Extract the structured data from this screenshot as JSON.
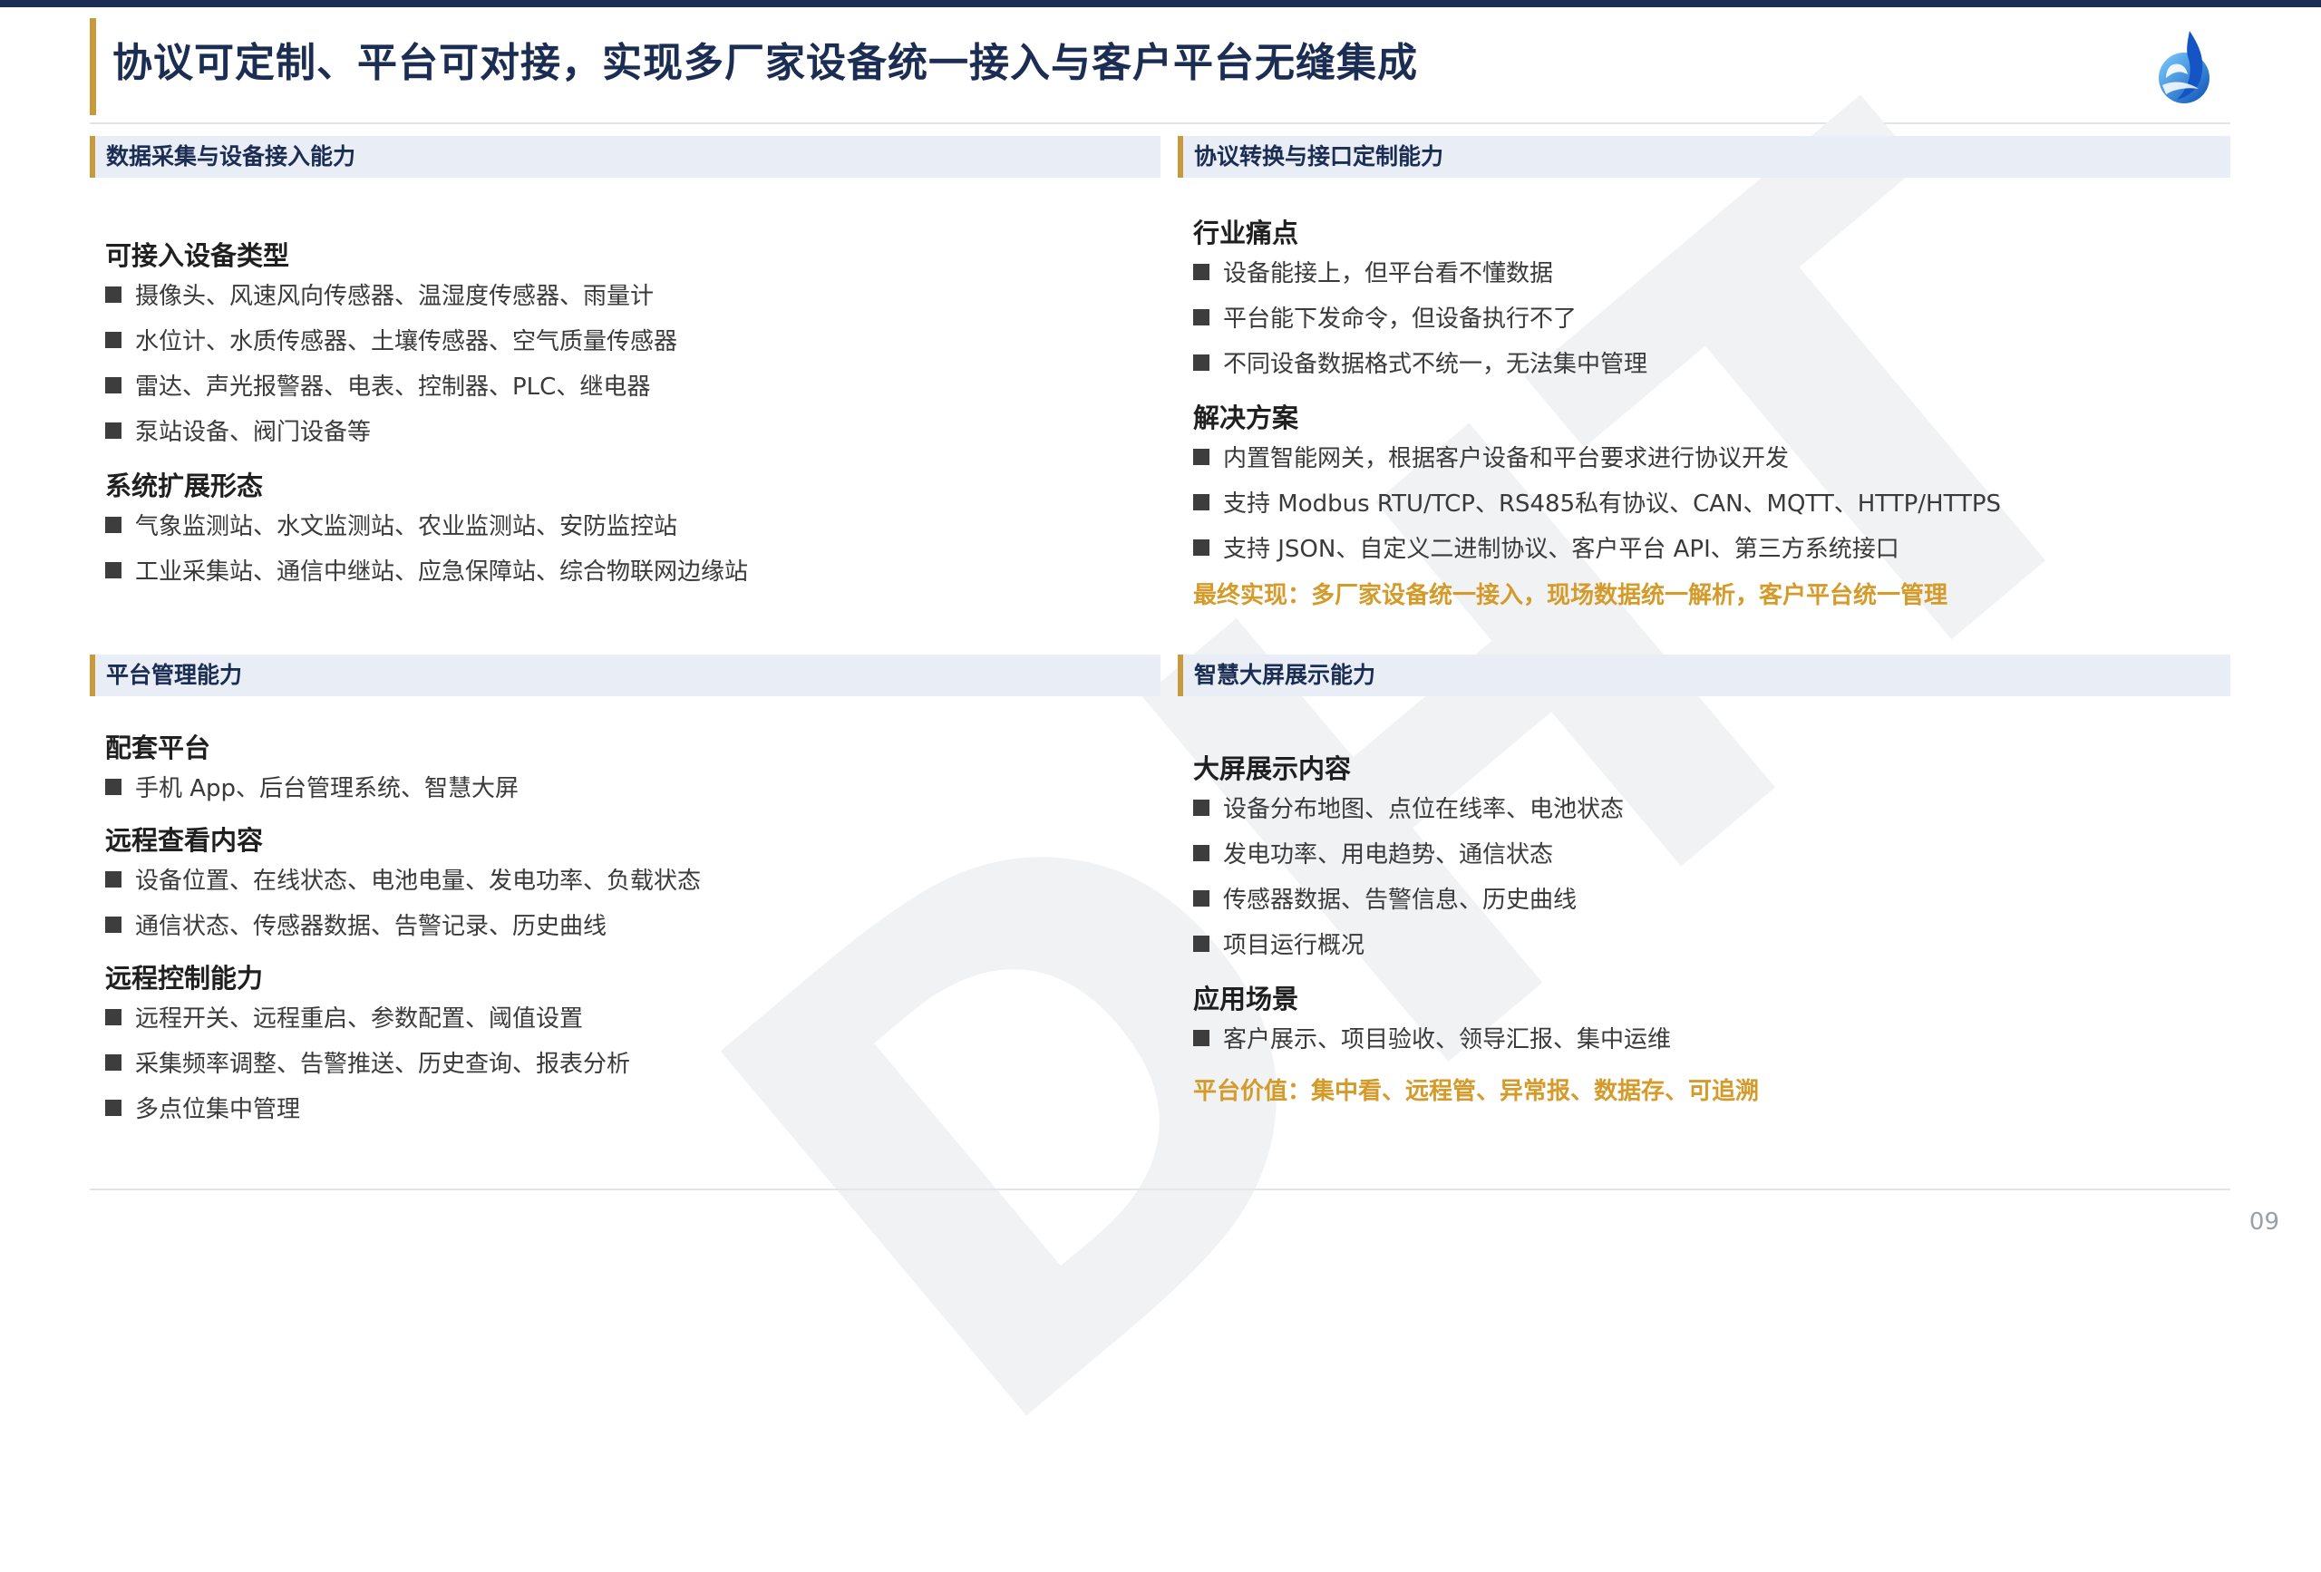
{
  "header": {
    "title": "协议可定制、平台可对接，实现多厂家设备统一接入与客户平台无缝集成",
    "logo_icon": "company-logo-icon"
  },
  "watermark": "DHT",
  "page_number": "09",
  "colors": {
    "navy": "#1b2d52",
    "gold": "#c99a3c",
    "highlight": "#d49a2a",
    "header_bg": "#e9edf6"
  },
  "sections": {
    "data_collection": {
      "header": "数据采集与设备接入能力",
      "groups": [
        {
          "title": "可接入设备类型",
          "items": [
            "摄像头、风速风向传感器、温湿度传感器、雨量计",
            "水位计、水质传感器、土壤传感器、空气质量传感器",
            "雷达、声光报警器、电表、控制器、PLC、继电器",
            "泵站设备、阀门设备等"
          ]
        },
        {
          "title": "系统扩展形态",
          "items": [
            "气象监测站、水文监测站、农业监测站、安防监控站",
            "工业采集站、通信中继站、应急保障站、综合物联网边缘站"
          ]
        }
      ]
    },
    "protocol": {
      "header": "协议转换与接口定制能力",
      "groups": [
        {
          "title": "行业痛点",
          "items": [
            "设备能接上，但平台看不懂数据",
            "平台能下发命令，但设备执行不了",
            "不同设备数据格式不统一，无法集中管理"
          ]
        },
        {
          "title": "解决方案",
          "items": [
            "内置智能网关，根据客户设备和平台要求进行协议开发",
            "支持 Modbus RTU/TCP、RS485私有协议、CAN、MQTT、HTTP/HTTPS",
            "支持 JSON、自定义二进制协议、客户平台 API、第三方系统接口"
          ]
        }
      ],
      "highlight": "最终实现：多厂家设备统一接入，现场数据统一解析，客户平台统一管理"
    },
    "platform": {
      "header": "平台管理能力",
      "groups": [
        {
          "title": "配套平台",
          "items": [
            "手机 App、后台管理系统、智慧大屏"
          ]
        },
        {
          "title": "远程查看内容",
          "items": [
            "设备位置、在线状态、电池电量、发电功率、负载状态",
            "通信状态、传感器数据、告警记录、历史曲线"
          ]
        },
        {
          "title": "远程控制能力",
          "items": [
            "远程开关、远程重启、参数配置、阈值设置",
            "采集频率调整、告警推送、历史查询、报表分析",
            "多点位集中管理"
          ]
        }
      ]
    },
    "dashboard": {
      "header": "智慧大屏展示能力",
      "groups": [
        {
          "title": "大屏展示内容",
          "items": [
            "设备分布地图、点位在线率、电池状态",
            "发电功率、用电趋势、通信状态",
            "传感器数据、告警信息、历史曲线",
            "项目运行概况"
          ]
        },
        {
          "title": "应用场景",
          "items": [
            "客户展示、项目验收、领导汇报、集中运维"
          ]
        }
      ],
      "highlight": "平台价值：集中看、远程管、异常报、数据存、可追溯"
    }
  }
}
